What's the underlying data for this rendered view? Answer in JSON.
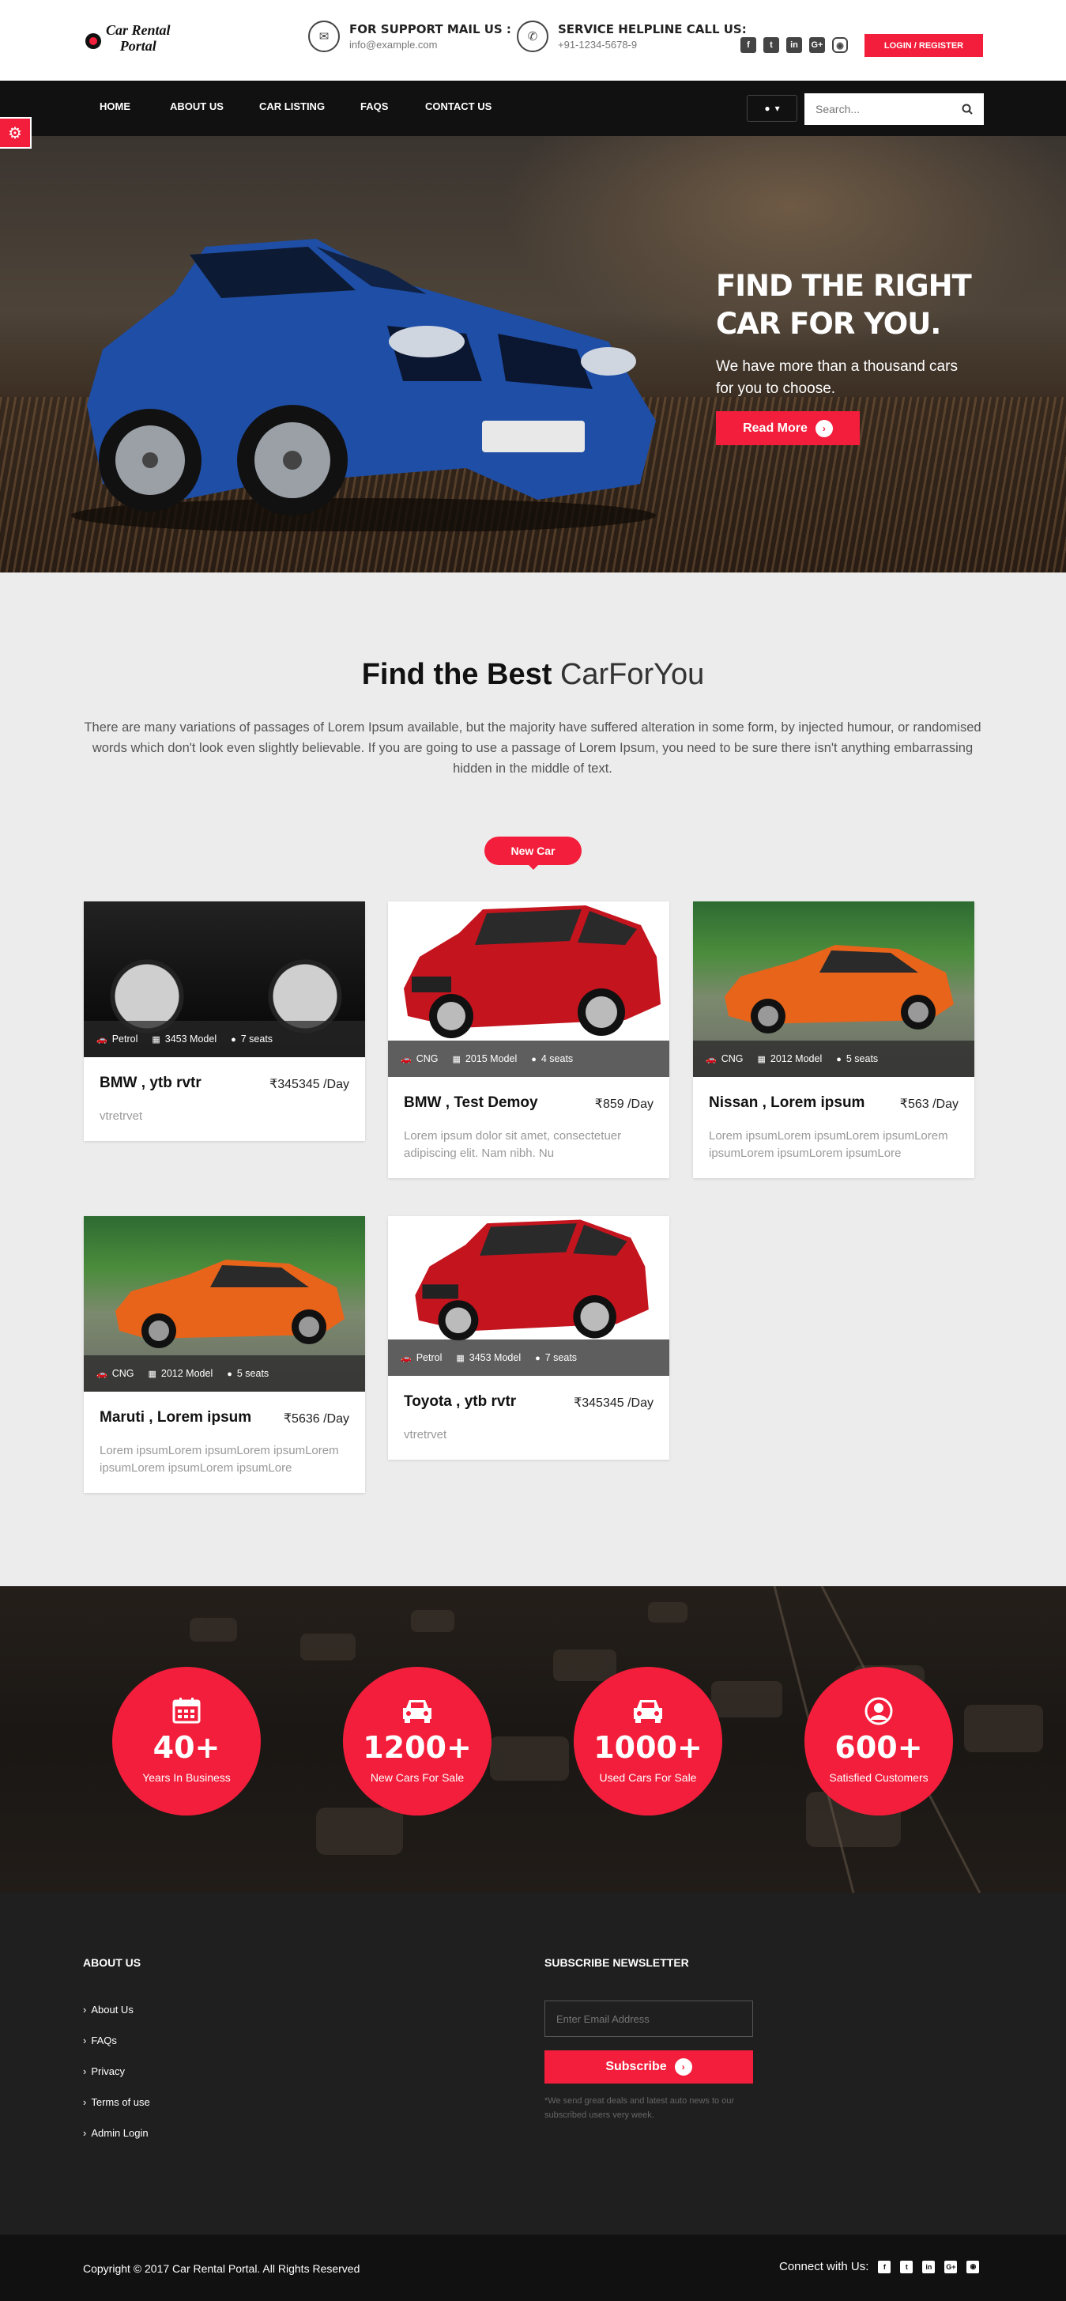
{
  "brand": {
    "name_line1": "Car Rental",
    "name_line2": "Portal"
  },
  "header": {
    "support_title": "FOR SUPPORT MAIL US :",
    "support_value": "info@example.com",
    "helpline_title": "SERVICE HELPLINE CALL US:",
    "helpline_value": "+91-1234-5678-9",
    "social": [
      "facebook-icon",
      "twitter-icon",
      "linkedin-icon",
      "google-plus-icon",
      "instagram-icon"
    ],
    "login_label": "LOGIN / REGISTER"
  },
  "nav": {
    "items": [
      "HOME",
      "ABOUT US",
      "CAR LISTING",
      "FAQS",
      "CONTACT US"
    ],
    "search_placeholder": "Search..."
  },
  "hero": {
    "title_line1": "FIND THE RIGHT",
    "title_line2": "CAR FOR YOU.",
    "subtitle": "We have more than a thousand cars for you to choose.",
    "button": "Read More"
  },
  "section": {
    "title_bold": "Find the Best",
    "title_light": "CarForYou",
    "description": "There are many variations of passages of Lorem Ipsum available, but the majority have suffered alteration in some form, by injected humour, or randomised words which don't look even slightly believable. If you are going to use a passage of Lorem Ipsum, you need to be sure there isn't anything embarrassing hidden in the middle of text.",
    "tab": "New Car"
  },
  "cars": [
    {
      "name": "BMW , ytb rvtr",
      "price": "₹345345 /Day",
      "fuel": "Petrol",
      "model": "3453 Model",
      "seats": "7 seats",
      "desc": "vtretrvet"
    },
    {
      "name": "BMW , Test Demoy",
      "price": "₹859 /Day",
      "fuel": "CNG",
      "model": "2015 Model",
      "seats": "4 seats",
      "desc": "Lorem ipsum dolor sit amet, consectetuer adipiscing elit. Nam nibh. Nu"
    },
    {
      "name": "Nissan , Lorem ipsum",
      "price": "₹563 /Day",
      "fuel": "CNG",
      "model": "2012 Model",
      "seats": "5 seats",
      "desc": "Lorem ipsumLorem ipsumLorem ipsumLorem ipsumLorem ipsumLorem ipsumLore"
    },
    {
      "name": "Maruti , Lorem ipsum",
      "price": "₹5636 /Day",
      "fuel": "CNG",
      "model": "2012 Model",
      "seats": "5 seats",
      "desc": "Lorem ipsumLorem ipsumLorem ipsumLorem ipsumLorem ipsumLorem ipsumLore"
    },
    {
      "name": "Toyota , ytb rvtr",
      "price": "₹345345 /Day",
      "fuel": "Petrol",
      "model": "3453 Model",
      "seats": "7 seats",
      "desc": "vtretrvet"
    }
  ],
  "stats": [
    {
      "num": "40+",
      "label": "Years In Business",
      "icon": "calendar-icon"
    },
    {
      "num": "1200+",
      "label": "New Cars For Sale",
      "icon": "car-icon"
    },
    {
      "num": "1000+",
      "label": "Used Cars For Sale",
      "icon": "car-icon"
    },
    {
      "num": "600+",
      "label": "Satisfied Customers",
      "icon": "user-circle-icon"
    }
  ],
  "footer": {
    "about_title": "ABOUT US",
    "links": [
      "About Us",
      "FAQs",
      "Privacy",
      "Terms of use",
      "Admin Login"
    ],
    "newsletter_title": "SUBSCRIBE NEWSLETTER",
    "email_placeholder": "Enter Email Address",
    "subscribe": "Subscribe",
    "note": "*We send great deals and latest auto news to our subscribed users very week.",
    "copyright": "Copyright © 2017 Car Rental Portal. All Rights Reserved",
    "connect": "Connect with Us:"
  },
  "colors": {
    "accent": "#f31e3b",
    "dark": "#111111",
    "footer": "#1f1f1f"
  }
}
